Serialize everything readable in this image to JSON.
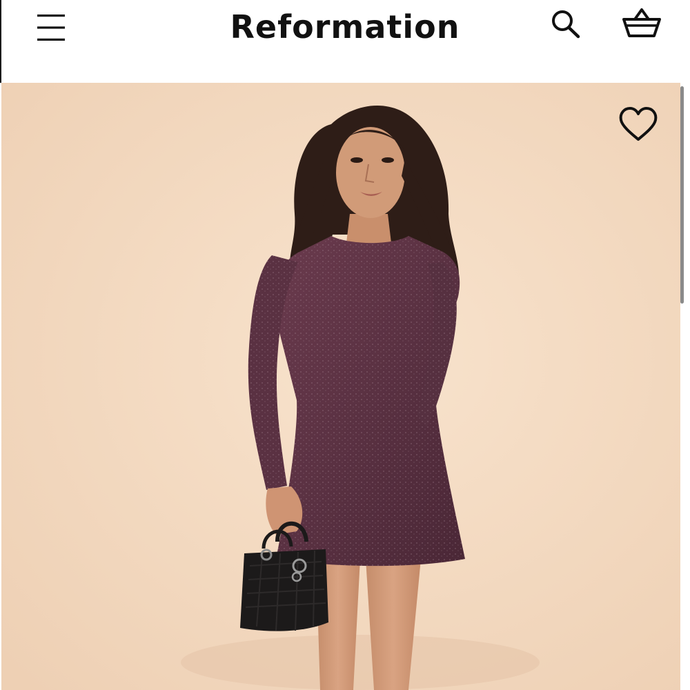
{
  "header": {
    "brand": "Reformation",
    "menu_icon": "hamburger-menu-icon",
    "search_icon": "search-icon",
    "bag_icon": "shopping-basket-icon"
  },
  "product_image": {
    "wishlist_icon": "heart-outline-icon",
    "background_color": "#f4ddc6",
    "dress_color": "#5c3344",
    "handbag_color": "#1c1a1a"
  },
  "colors": {
    "header_background": "#ffffff",
    "text": "#111111"
  }
}
